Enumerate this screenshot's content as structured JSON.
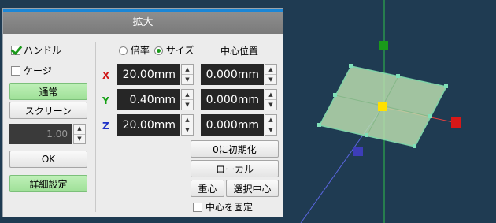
{
  "dialog": {
    "title": "拡大",
    "left": {
      "handle_label": "ハンドル",
      "handle_checked": true,
      "gauge_label": "ケージ",
      "gauge_checked": false,
      "mode_normal": "通常",
      "mode_screen": "スクリーン",
      "value": "1.00",
      "ok_label": "OK",
      "detail_label": "詳細設定"
    },
    "right": {
      "mode_ratio": "倍率",
      "mode_size": "サイズ",
      "selected_mode": "サイズ",
      "center_pos_header": "中心位置",
      "rows": [
        {
          "axis": "X",
          "axis_color": "#d01818",
          "size": "20.00mm",
          "center": "0.000mm"
        },
        {
          "axis": "Y",
          "axis_color": "#15a015",
          "size": "0.40mm",
          "center": "0.000mm"
        },
        {
          "axis": "Z",
          "axis_color": "#2033c8",
          "size": "20.00mm",
          "center": "0.000mm"
        }
      ],
      "reset_label": "0に初期化",
      "local_label": "ローカル",
      "centroid_label": "重心",
      "selection_center_label": "選択中心",
      "fix_center_label": "中心を固定",
      "fix_center_checked": false
    }
  },
  "scene": {
    "background": "#1f3b52",
    "plane_color": "#b8dcae",
    "x_axis_color": "#e02020",
    "y_axis_color": "#20b020",
    "z_axis_color": "#4a4ad8",
    "center_color": "#ffe000"
  }
}
